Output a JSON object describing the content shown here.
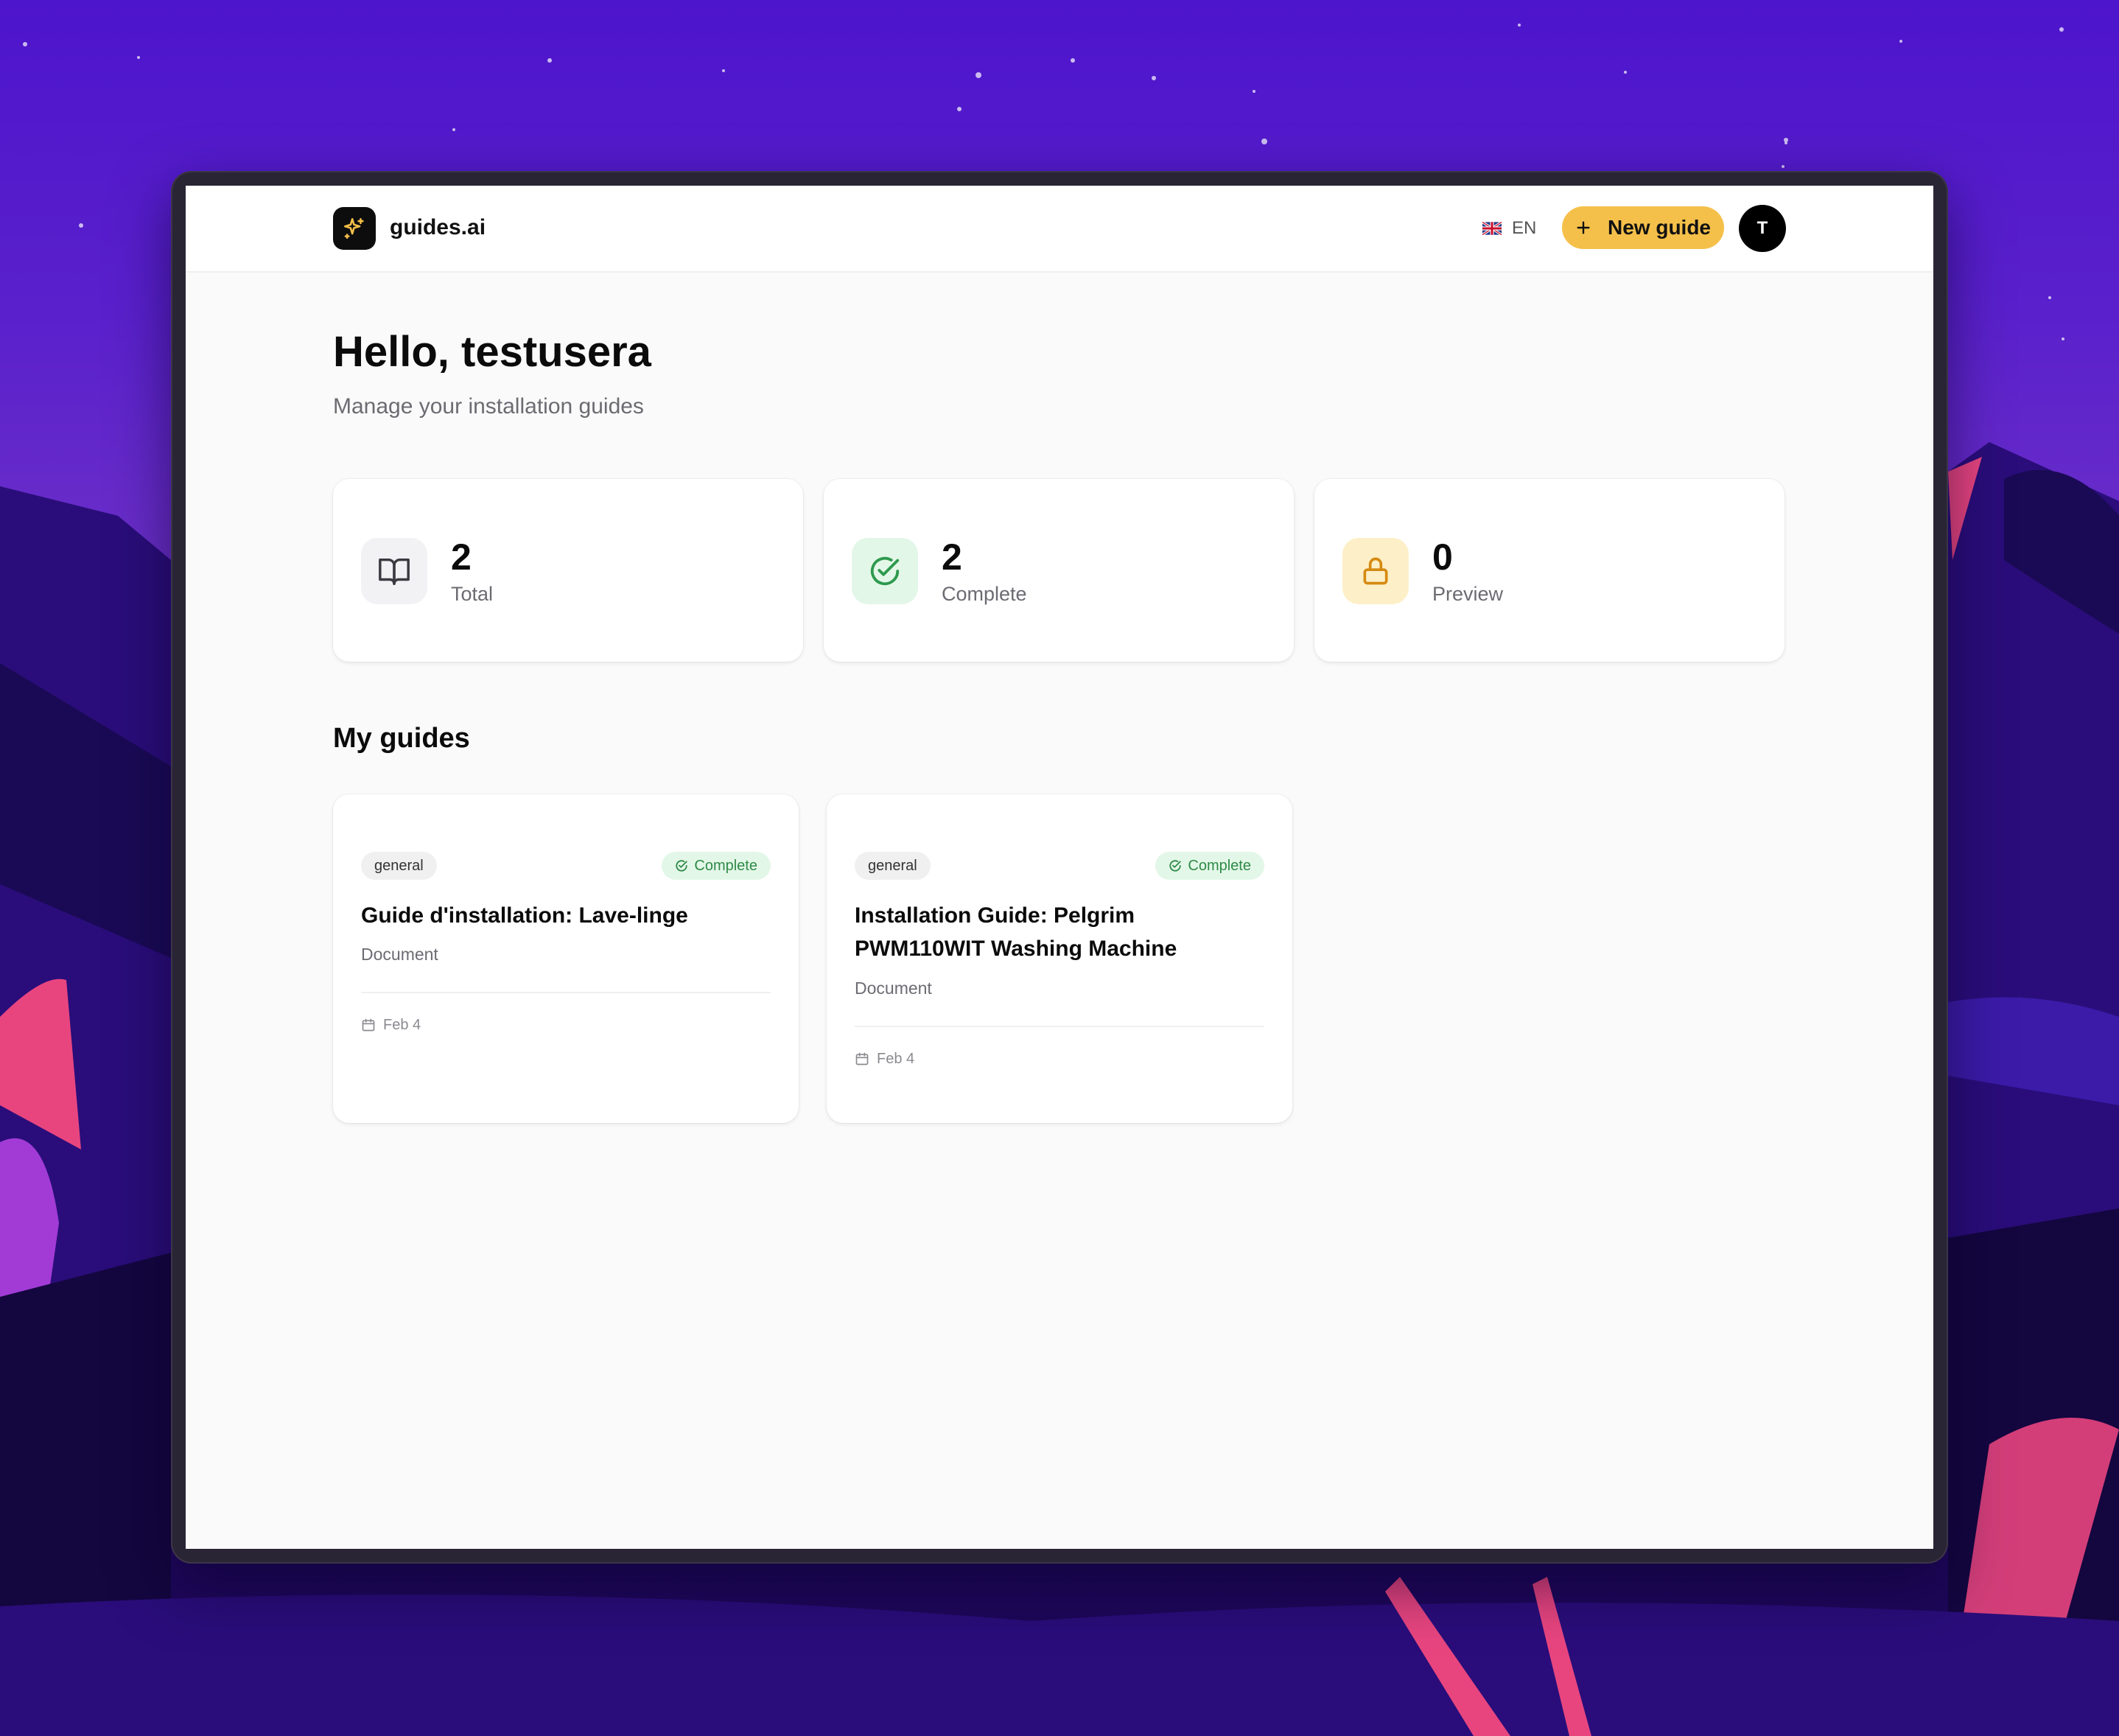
{
  "header": {
    "brand": "guides.ai",
    "language": "EN",
    "new_guide_label": "New guide",
    "avatar_initial": "T"
  },
  "main": {
    "greeting": "Hello, testusera",
    "subtitle": "Manage your installation guides",
    "stats": [
      {
        "value": "2",
        "label": "Total",
        "icon": "book-open-icon",
        "color": "#f2f2f4"
      },
      {
        "value": "2",
        "label": "Complete",
        "icon": "check-circle-icon",
        "color": "#e3f7e8"
      },
      {
        "value": "0",
        "label": "Preview",
        "icon": "lock-icon",
        "color": "#fdf0c8"
      }
    ],
    "section_title": "My guides",
    "guides": [
      {
        "category": "general",
        "status": "Complete",
        "title": "Guide d'installation: Lave-linge",
        "type": "Document",
        "date": "Feb 4"
      },
      {
        "category": "general",
        "status": "Complete",
        "title": "Installation Guide: Pelgrim PWM110WIT Washing Machine",
        "type": "Document",
        "date": "Feb 4"
      }
    ]
  },
  "colors": {
    "accent": "#f5c04a",
    "complete_green": "#2e8a47",
    "lock_amber": "#d68a12"
  }
}
